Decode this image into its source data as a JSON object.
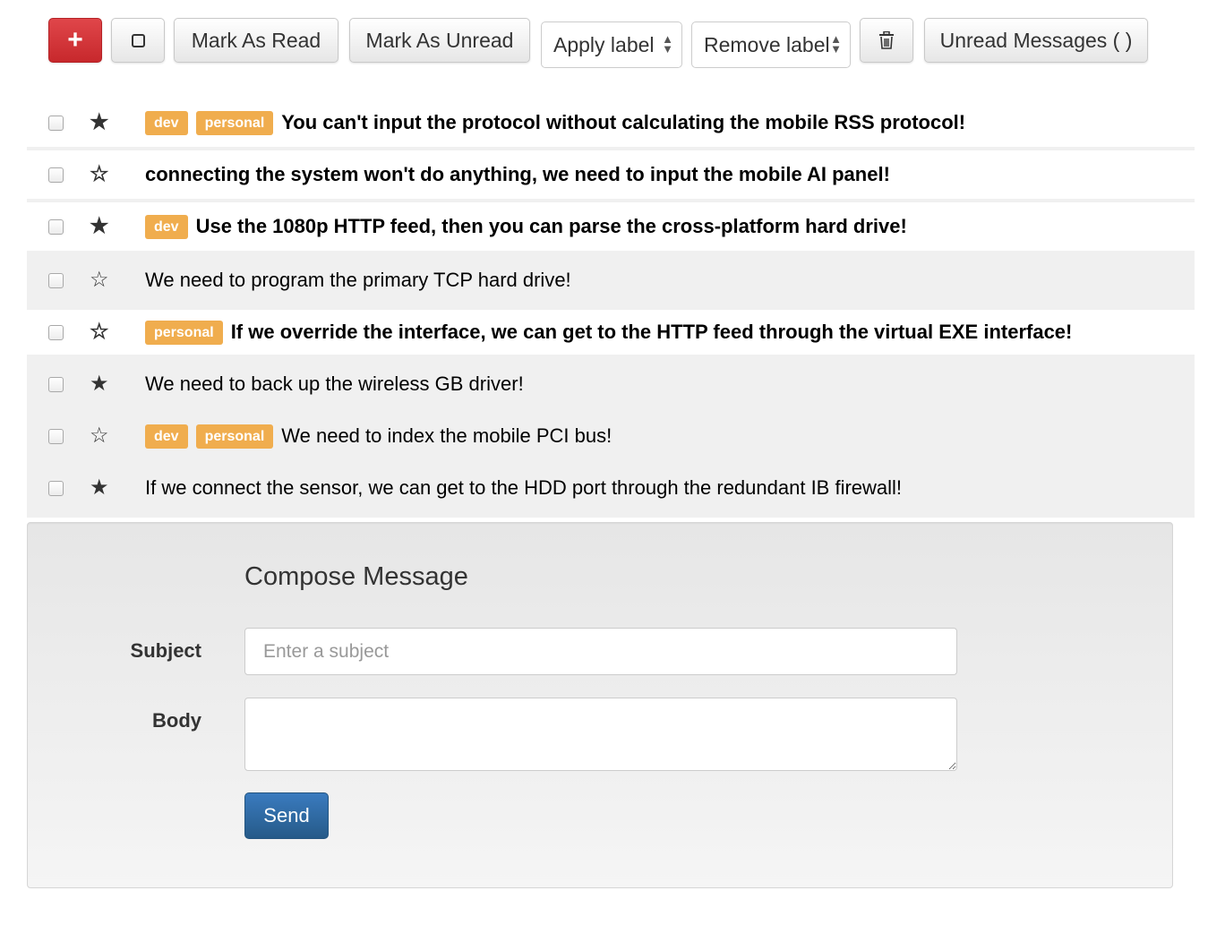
{
  "toolbar": {
    "compose_icon": "+",
    "select_icon": "checkbox-empty-icon",
    "mark_read_label": "Mark As Read",
    "mark_unread_label": "Mark As Unread",
    "apply_label": "Apply label",
    "remove_label": "Remove label",
    "delete_icon": "trash-icon",
    "unread_label": "Unread Messages ( )"
  },
  "messages": [
    {
      "starred": true,
      "read": false,
      "labels": [
        "dev",
        "personal"
      ],
      "subject": "You can't input the protocol without calculating the mobile RSS protocol!"
    },
    {
      "starred": false,
      "read": false,
      "labels": [],
      "subject": "connecting the system won't do anything, we need to input the mobile AI panel!"
    },
    {
      "starred": true,
      "read": false,
      "labels": [
        "dev"
      ],
      "subject": "Use the 1080p HTTP feed, then you can parse the cross-platform hard drive!"
    },
    {
      "starred": false,
      "read": true,
      "labels": [],
      "subject": "We need to program the primary TCP hard drive!"
    },
    {
      "starred": false,
      "read": false,
      "labels": [
        "personal"
      ],
      "subject": "If we override the interface, we can get to the HTTP feed through the virtual EXE interface!"
    },
    {
      "starred": true,
      "read": true,
      "labels": [],
      "subject": "We need to back up the wireless GB driver!"
    },
    {
      "starred": false,
      "read": true,
      "labels": [
        "dev",
        "personal"
      ],
      "subject": "We need to index the mobile PCI bus!"
    },
    {
      "starred": true,
      "read": true,
      "labels": [],
      "subject": "If we connect the sensor, we can get to the HDD port through the redundant IB firewall!"
    }
  ],
  "compose": {
    "title": "Compose Message",
    "subject_label": "Subject",
    "subject_placeholder": "Enter a subject",
    "subject_value": "",
    "body_label": "Body",
    "body_value": "",
    "send_label": "Send"
  },
  "colors": {
    "label_bg": "#f0ad4e",
    "compose_button": "#d9363a",
    "send_button": "#2e6da4",
    "read_row_bg": "#f0f0f0"
  }
}
